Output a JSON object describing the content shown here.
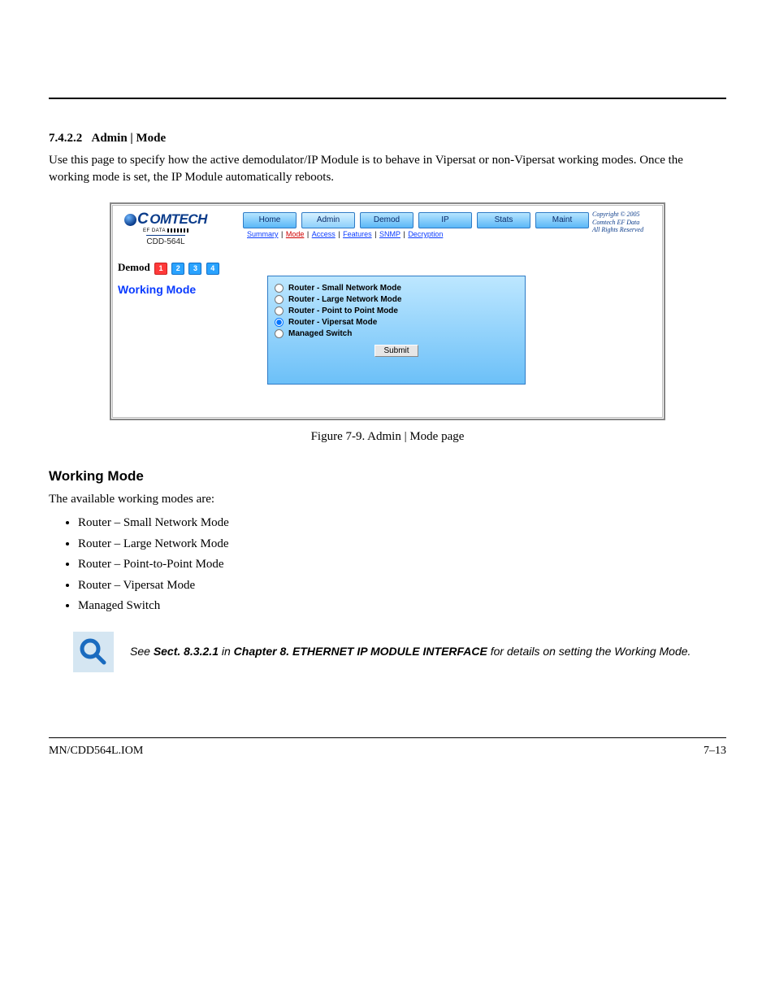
{
  "doc": {
    "section_num": "7.4.2.2",
    "section_title": "Admin | Mode",
    "intro": "Use this page to specify how the active demodulator/IP Module is to behave in Vipersat or non-Vipersat working modes. Once the working mode is set, the IP Module automatically reboots.",
    "figure_caption": "Figure 7-9. Admin | Mode page",
    "working_mode_heading": "Working Mode",
    "available_modes_intro": "The available working modes are:",
    "modes_list": [
      "Router – Small Network Mode",
      "Router – Large Network Mode",
      "Router – Point-to-Point Mode",
      "Router – Vipersat Mode",
      "Managed Switch"
    ],
    "note": "See Sect. 8.3.2.1 in Chapter 8. ETHERNET IP MODULE INTERFACE for details on setting the Working Mode.",
    "footer_left": "MN/CDD564L.IOM",
    "footer_right": "7–13"
  },
  "screenshot": {
    "logo": {
      "brand": "OMTECH",
      "tagline": "EF DATA",
      "model": "CDD-564L"
    },
    "demod_label": "Demod",
    "demod_tabs": [
      "1",
      "2",
      "3",
      "4"
    ],
    "working_mode_label": "Working Mode",
    "nav_tabs": [
      "Home",
      "Admin",
      "Demod",
      "IP",
      "Stats",
      "Maint"
    ],
    "subnav": [
      "Summary",
      "Mode",
      "Access",
      "Features",
      "SNMP",
      "Decryption"
    ],
    "radio_options": [
      "Router - Small Network Mode",
      "Router - Large Network Mode",
      "Router - Point to Point Mode",
      "Router - Vipersat Mode",
      "Managed Switch"
    ],
    "selected_index": 3,
    "submit_label": "Submit",
    "copyright": [
      "Copyright © 2005",
      "Comtech EF Data",
      "All Rights Reserved"
    ]
  }
}
